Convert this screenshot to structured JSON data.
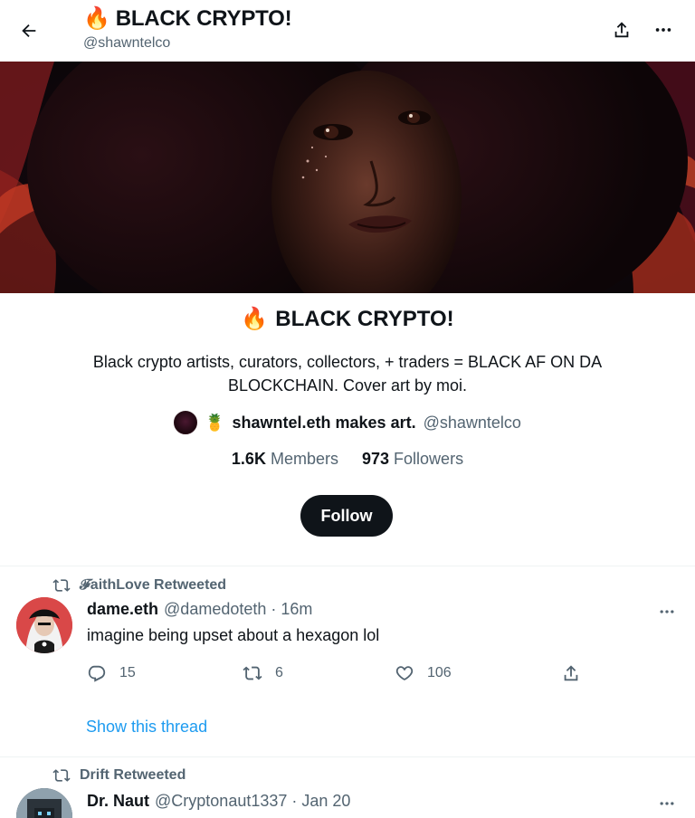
{
  "header": {
    "title_emoji": "🔥",
    "title": "BLACK CRYPTO!",
    "handle": "@shawntelco"
  },
  "community": {
    "title_emoji": "🔥",
    "title": "BLACK CRYPTO!",
    "description": "Black crypto artists, curators, collectors, + traders = BLACK AF ON DA BLOCKCHAIN. Cover art by moi.",
    "owner_emoji": "🍍",
    "owner_name": "shawntel.eth makes art.",
    "owner_handle": "@shawntelco",
    "members_count": "1.6K",
    "members_label": "Members",
    "followers_count": "973",
    "followers_label": "Followers",
    "follow_label": "Follow"
  },
  "tweets": [
    {
      "retweeted_by": "𝓕aithLove Retweeted",
      "name": "dame.eth",
      "handle_time": "@damedoteth · 16m",
      "text": "imagine being upset about a hexagon lol",
      "replies": "15",
      "retweets": "6",
      "likes": "106",
      "thread_link": "Show this thread"
    },
    {
      "retweeted_by": "Drift Retweeted",
      "name": "Dr. Naut",
      "handle_time": "@Cryptonaut1337 · Jan 20"
    }
  ],
  "colors": {
    "text": "#0f1419",
    "secondary": "#536471",
    "link": "#1d9bf0",
    "button": "#0f1419"
  }
}
